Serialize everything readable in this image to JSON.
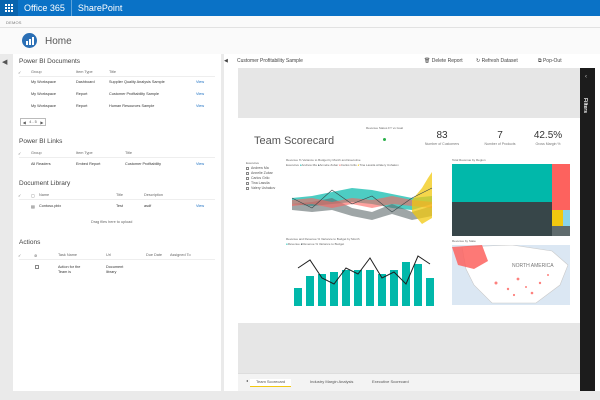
{
  "topbar": {
    "app": "Office 365",
    "site": "SharePoint"
  },
  "crumb": "DEMOS",
  "home": {
    "title": "Home"
  },
  "powerbi_docs": {
    "title": "Power BI Documents",
    "headers": [
      "Group",
      "Item Type",
      "Title"
    ],
    "rows": [
      {
        "group": "My Workspace",
        "type": "Dashboard",
        "title": "Supplier Quality Analysis Sample",
        "action": "View"
      },
      {
        "group": "My Workspace",
        "type": "Report",
        "title": "Customer Profitability Sample",
        "action": "View"
      },
      {
        "group": "My Workspace",
        "type": "Report",
        "title": "Human Resources Sample",
        "action": "View"
      }
    ],
    "pager": {
      "prev": "◀",
      "range": "4 - 5",
      "next": "▶"
    }
  },
  "powerbi_links": {
    "title": "Power BI Links",
    "headers": [
      "Group",
      "Item Type",
      "Title"
    ],
    "rows": [
      {
        "group": "All Readers",
        "type": "Embed Report",
        "title": "Customer Profitability",
        "action": "View"
      }
    ]
  },
  "doc_library": {
    "title": "Document Library",
    "headers": [
      "Name",
      "Title",
      "Description"
    ],
    "rows": [
      {
        "name": "Contoso.pbix",
        "title": "Test",
        "description": "asdf",
        "action": "View"
      }
    ],
    "drag_text": "Drag files here to upload"
  },
  "actions": {
    "title": "Actions",
    "headers": [
      "Task Name",
      "Url",
      "Due Date",
      "Assigned To"
    ],
    "rows": [
      {
        "task": "Action for the Team is",
        "url": "Document library"
      }
    ]
  },
  "report_header": {
    "title": "Customer Profitability Sample",
    "delete": "Delete Report",
    "refresh": "Refresh Dataset",
    "popout": "Pop-Out",
    "filters": "Filters"
  },
  "report": {
    "title": "Team Scorecard",
    "status_label": "Revenue Status FY vs Goal",
    "kpis": [
      {
        "value": "83",
        "label": "Number of Customers"
      },
      {
        "value": "7",
        "label": "Number of Products"
      },
      {
        "value": "42.5%",
        "label": "Gross Margin %"
      }
    ],
    "slicer": {
      "title": "Executive",
      "items": [
        "Andrew Ma",
        "Annelie Zubar",
        "Carlos Grilo",
        "Tina Lassila",
        "Valery Ushakov"
      ]
    },
    "area_title": "Revenue % Variance to Budget by Month and Executive",
    "area_legend": [
      "Executive",
      "Andrew Ma",
      "Annelie Zubar",
      "Carlos Grilo",
      "Tina Lassila",
      "Valery Ushakov"
    ],
    "treemap_title": "Total Revenue by Region",
    "combo_title": "Revenue and Revenue % Variance to Budget by Month",
    "combo_legend": [
      "Revenue",
      "Revenue % Variance to Budget"
    ],
    "map_title": "Revenue by State",
    "map_label": "NORTH AMERICA",
    "tabs": [
      "Team Scorecard",
      "Industry Margin Analysis",
      "Executive Scorecard"
    ]
  },
  "colors": {
    "topbar": "#0a72c6",
    "teal": "#01b8aa",
    "dark": "#374649",
    "red": "#fd625e",
    "yellow": "#f2c80f",
    "gray": "#5f6b6d",
    "link": "#1a6fc2"
  }
}
